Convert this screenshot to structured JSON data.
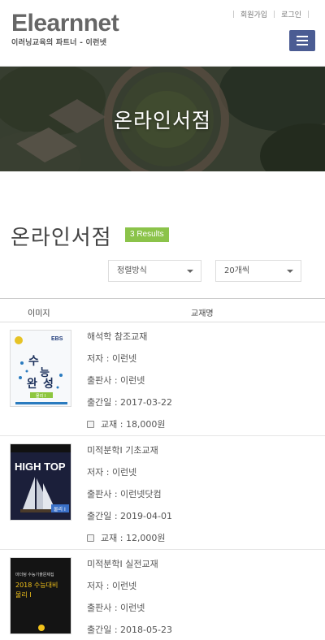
{
  "header": {
    "logo_main": "Elearnnet",
    "logo_sub": "이러닝교육의 파트너 - 이런넷",
    "signup": "회원가입",
    "login": "로그인"
  },
  "banner": {
    "title": "온라인서점"
  },
  "page": {
    "title": "온라인서점",
    "results": "3 Results"
  },
  "filters": {
    "sort": "정렬방식",
    "count": "20개씩"
  },
  "table": {
    "col_image": "이미지",
    "col_name": "교재명"
  },
  "books": [
    {
      "title": "해석학 참조교재",
      "author": "저자 : 이런넷",
      "publisher": "출판사 : 이런넷",
      "date": "출간일 : 2017-03-22",
      "price": "교재 : 18,000원",
      "cover": {
        "top_text": "EBS",
        "big_text": "수능완성",
        "sub_text": "물리 I"
      }
    },
    {
      "title": "미적분학I 기초교재",
      "author": "저자 : 이런넷",
      "publisher": "출판사 : 이런넷닷컴",
      "date": "출간일 : 2019-04-01",
      "price": "교재 : 12,000원",
      "cover": {
        "big_text": "HIGH TOP",
        "sub_text": "물리 I"
      }
    },
    {
      "title": "미적분학I 실전교재",
      "author": "저자 : 이런넷",
      "publisher": "출판사 : 이런넷",
      "date": "출간일 : 2018-05-23",
      "price": "",
      "cover": {
        "top_text": "마더텅 수능기출문제집",
        "big_text": "2018 수능대비",
        "sub_text": "물리 I"
      }
    }
  ]
}
